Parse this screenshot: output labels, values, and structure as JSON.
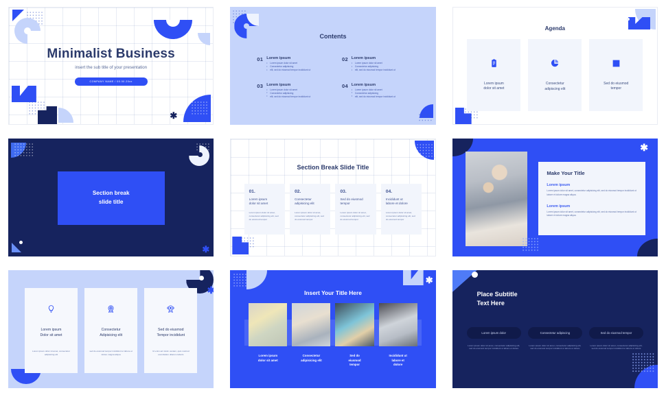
{
  "theme": {
    "blue": "#2f4ff5",
    "navy": "#16235e",
    "light_blue": "#c5d4fb",
    "card_bg": "#f2f5fc",
    "title_ink": "#2b3a6b"
  },
  "slides": [
    {
      "id": "title-slide",
      "title": "Minimalist Business",
      "subtitle": "insert the sub title of your presentation",
      "badge": "COMPANY NAME  /  00.00.20xx"
    },
    {
      "id": "contents-slide",
      "title": "Contents",
      "items": [
        {
          "num": "01",
          "heading": "Lorem ipsum",
          "bullets": [
            "Lorem ipsum dolor sit amet",
            "Consectetur adipisicing",
            "elit, sed do eiusmod tempor incididunt ut"
          ]
        },
        {
          "num": "02",
          "heading": "Lorem ipsum",
          "bullets": [
            "Lorem ipsum dolor sit amet",
            "Consectetur adipisicing",
            "elit, sed do eiusmod tempor incididunt ut"
          ]
        },
        {
          "num": "03",
          "heading": "Lorem ipsum",
          "bullets": [
            "Lorem ipsum dolor sit amet",
            "Consectetur adipisicing",
            "elit, sed do eiusmod tempor incididunt ut"
          ]
        },
        {
          "num": "04",
          "heading": "Lorem ipsum",
          "bullets": [
            "Lorem ipsum dolor sit amet",
            "Consectetur adipisicing",
            "elit, sed do eiusmod tempor incididunt ut"
          ]
        }
      ]
    },
    {
      "id": "agenda-slide",
      "title": "Agenda",
      "cards": [
        {
          "icon": "clipboard-list-icon",
          "label": "Lorem ipsum\ndolor sit amet"
        },
        {
          "icon": "pie-chart-icon",
          "label": "Consectetur\nadipiscing elit"
        },
        {
          "icon": "bar-chart-icon",
          "label": "Sed do eiusmod\ntempor"
        }
      ]
    },
    {
      "id": "section-break-slide",
      "box_title": "Section break\nslide title"
    },
    {
      "id": "section-break-columns-slide",
      "title": "Section Break Slide Title",
      "columns": [
        {
          "num": "01.",
          "heading": "Lorem ipsum\ndolor sit amet",
          "body": "Lorem ipsum dolor sit amet, consectetur adipisicing elit, sed do eiusmod tempor"
        },
        {
          "num": "02.",
          "heading": "Consectetur\nadipisicing elit",
          "body": "Lorem ipsum dolor sit amet, consectetur adipisicing elit, sed do eiusmod tempor"
        },
        {
          "num": "03.",
          "heading": "Sed do eiusmod\ntempor",
          "body": "Lorem ipsum dolor sit amet, consectetur adipisicing elit, sed do eiusmod tempor"
        },
        {
          "num": "04.",
          "heading": "Incididunt ut\nlabore et dolore",
          "body": "Lorem ipsum dolor sit amet, consectetur adipisicing elit, sed do eiusmod tempor"
        }
      ]
    },
    {
      "id": "image-text-slide",
      "panel_title": "Make Your Title",
      "blocks": [
        {
          "heading": "Lorem ipsum",
          "body": "Lorem ipsum dolor sit amet, consectetur adipisicing elit, sed do eiusmod tempor incididunt ut labore et dolore magna aliqua."
        },
        {
          "heading": "Lorem ipsum",
          "body": "Lorem ipsum dolor sit amet, consectetur adipisicing elit, sed do eiusmod tempor incididunt ut labore et dolore magna aliqua."
        }
      ],
      "photo_alt": "team-working-photo"
    },
    {
      "id": "three-feature-cards-slide",
      "cards": [
        {
          "icon": "lightbulb-icon",
          "heading": "Lorem ipsum\nDolor sit amet",
          "body": "Lorem ipsum dolor sit amet, consectetur adipisicing elit"
        },
        {
          "icon": "target-badge-icon",
          "heading": "Consectetur\nAdipisicing elit",
          "body": "sed do eiusmod tempor incididunt ut labore et dolore magna aliqua"
        },
        {
          "icon": "award-ribbon-icon",
          "heading": "Sed do eiusmod\nTempor incididunt",
          "body": "Ut enim ad minim veniam, quis nostrud exercitation ullamco laboris"
        }
      ]
    },
    {
      "id": "photo-grid-slide",
      "title": "Insert Your Title Here",
      "cells": [
        {
          "caption": "Lorem ipsum\ndolor sit amet",
          "photo_alt": "sticky-notes-photo"
        },
        {
          "caption": "Consectetur\nadipisicing elit",
          "photo_alt": "hands-drawing-photo"
        },
        {
          "caption": "Sed do\neiusmod\ntempor",
          "photo_alt": "tablet-wireframe-photo"
        },
        {
          "caption": "Incididunt ut\nlabore et\ndolore",
          "photo_alt": "desk-planning-photo"
        }
      ]
    },
    {
      "id": "dark-pills-slide",
      "title": "Place Subtitle\nText Here",
      "columns": [
        {
          "pill": "Lorem ipsum dolor",
          "body": "Lorem ipsum dolor sit amet, consectetur adipisicing elit, sed do eiusmod tempor incididunt ut labore et dolore"
        },
        {
          "pill": "Consectetur  adipiscing",
          "body": "Lorem ipsum dolor sit amet, consectetur adipisicing elit, sed do eiusmod tempor incididunt ut labore et dolore"
        },
        {
          "pill": "Sed do eiusmod tempor",
          "body": "Lorem ipsum dolor sit amet, consectetur adipisicing elit, sed do eiusmod tempor incididunt ut labore et dolore"
        }
      ]
    }
  ]
}
